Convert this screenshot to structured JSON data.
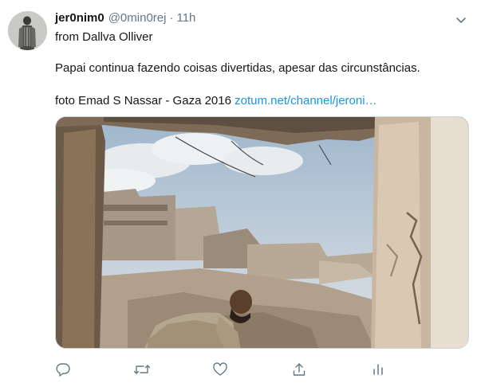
{
  "tweet": {
    "display_name": "jer0nim0",
    "handle": "@0min0rej",
    "separator": "·",
    "time": "11h",
    "line1": "from Dallva Olliver",
    "line2": "Papai continua fazendo coisas divertidas, apesar das circunstâncias.",
    "line3_prefix": "foto Emad S Nassar - Gaza 2016 ",
    "link_text": "zotum.net/channel/jeroni…"
  },
  "icons": {
    "more": "chevron-down-icon",
    "reply": "reply-icon",
    "retweet": "retweet-icon",
    "like": "heart-icon",
    "share": "share-icon",
    "analytics": "analytics-icon"
  },
  "colors": {
    "text": "#14171a",
    "secondary": "#657786",
    "link": "#1b95e0",
    "border": "#ccd6dd"
  }
}
